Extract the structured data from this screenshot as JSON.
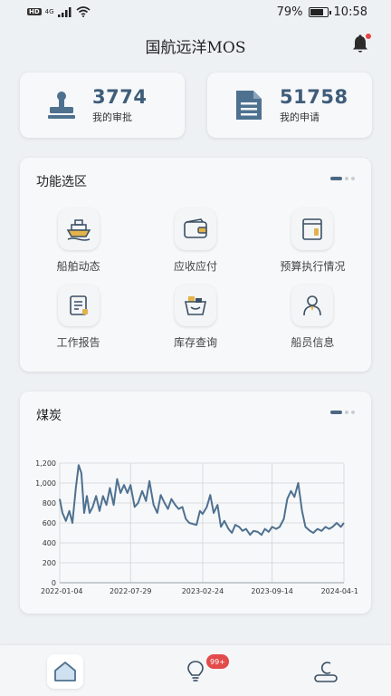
{
  "status_bar": {
    "hd": "HD",
    "network": "4G",
    "battery": "79%",
    "battery_level": 0.79,
    "time": "10:58"
  },
  "header": {
    "title": "国航远洋MOS",
    "bell_icon": "bell-icon",
    "has_notification_dot": true
  },
  "stats": [
    {
      "value": "3774",
      "label": "我的审批",
      "icon": "stamp-icon"
    },
    {
      "value": "51758",
      "label": "我的申请",
      "icon": "document-icon"
    }
  ],
  "functions": {
    "title": "功能选区",
    "pager": {
      "pages": 3,
      "active": 0
    },
    "items": [
      {
        "label": "船舶动态",
        "icon": "ship-icon"
      },
      {
        "label": "应收应付",
        "icon": "wallet-icon"
      },
      {
        "label": "预算执行情况",
        "icon": "budget-icon"
      },
      {
        "label": "工作报告",
        "icon": "report-icon"
      },
      {
        "label": "库存查询",
        "icon": "inventory-icon"
      },
      {
        "label": "船员信息",
        "icon": "crew-icon"
      }
    ]
  },
  "chart_panel": {
    "title": "煤炭",
    "pager": {
      "pages": 3,
      "active": 0
    }
  },
  "chart_data": {
    "type": "line",
    "title": "煤炭",
    "xlabel": "",
    "ylabel": "",
    "ylim": [
      0,
      1200
    ],
    "yticks": [
      "0",
      "200",
      "400",
      "600",
      "800",
      "1,000",
      "1,200"
    ],
    "xticks": [
      "2022-01-04",
      "2022-07-29",
      "2023-02-24",
      "2023-09-14",
      "2024-04-1"
    ],
    "grid": true,
    "color": "#4f7190",
    "x": [
      "2022-01-04",
      "2022-01-12",
      "2022-01-22",
      "2022-02-01",
      "2022-02-10",
      "2022-02-20",
      "2022-02-28",
      "2022-03-08",
      "2022-03-16",
      "2022-03-24",
      "2022-04-01",
      "2022-04-10",
      "2022-04-20",
      "2022-04-30",
      "2022-05-10",
      "2022-05-20",
      "2022-05-30",
      "2022-06-10",
      "2022-06-20",
      "2022-06-30",
      "2022-07-10",
      "2022-07-20",
      "2022-07-29",
      "2022-08-10",
      "2022-08-20",
      "2022-09-01",
      "2022-09-12",
      "2022-09-22",
      "2022-10-04",
      "2022-10-15",
      "2022-10-25",
      "2022-11-05",
      "2022-11-15",
      "2022-11-25",
      "2022-12-06",
      "2022-12-16",
      "2022-12-27",
      "2023-01-06",
      "2023-01-16",
      "2023-01-26",
      "2023-02-06",
      "2023-02-16",
      "2023-02-24",
      "2023-03-08",
      "2023-03-18",
      "2023-03-28",
      "2023-04-08",
      "2023-04-18",
      "2023-04-28",
      "2023-05-10",
      "2023-05-20",
      "2023-05-30",
      "2023-06-10",
      "2023-06-20",
      "2023-06-30",
      "2023-07-12",
      "2023-07-22",
      "2023-08-03",
      "2023-08-14",
      "2023-08-24",
      "2023-09-04",
      "2023-09-14",
      "2023-09-26",
      "2023-10-06",
      "2023-10-18",
      "2023-10-28",
      "2023-11-08",
      "2023-11-18",
      "2023-11-29",
      "2023-12-10",
      "2023-12-20",
      "2024-01-02",
      "2024-01-12",
      "2024-01-24",
      "2024-02-05",
      "2024-02-16",
      "2024-02-27",
      "2024-03-08",
      "2024-03-20",
      "2024-04-01",
      "2024-04-10"
    ],
    "series": [
      {
        "values": [
          840,
          700,
          620,
          720,
          600,
          950,
          1180,
          1100,
          700,
          870,
          700,
          760,
          870,
          720,
          870,
          780,
          950,
          780,
          1040,
          900,
          980,
          900,
          980,
          760,
          800,
          920,
          820,
          1020,
          780,
          700,
          880,
          800,
          740,
          840,
          780,
          740,
          760,
          640,
          600,
          590,
          580,
          720,
          690,
          760,
          880,
          700,
          780,
          560,
          620,
          540,
          500,
          580,
          560,
          520,
          540,
          480,
          520,
          510,
          480,
          540,
          510,
          560,
          540,
          560,
          640,
          840,
          920,
          860,
          1000,
          720,
          560,
          520,
          500,
          540,
          520,
          560,
          540,
          560,
          600,
          560,
          600
        ]
      }
    ]
  },
  "bottom_nav": {
    "items": [
      {
        "icon": "home-icon",
        "active": true
      },
      {
        "icon": "lightbulb-icon",
        "badge": "99+"
      },
      {
        "icon": "profile-icon"
      }
    ]
  }
}
